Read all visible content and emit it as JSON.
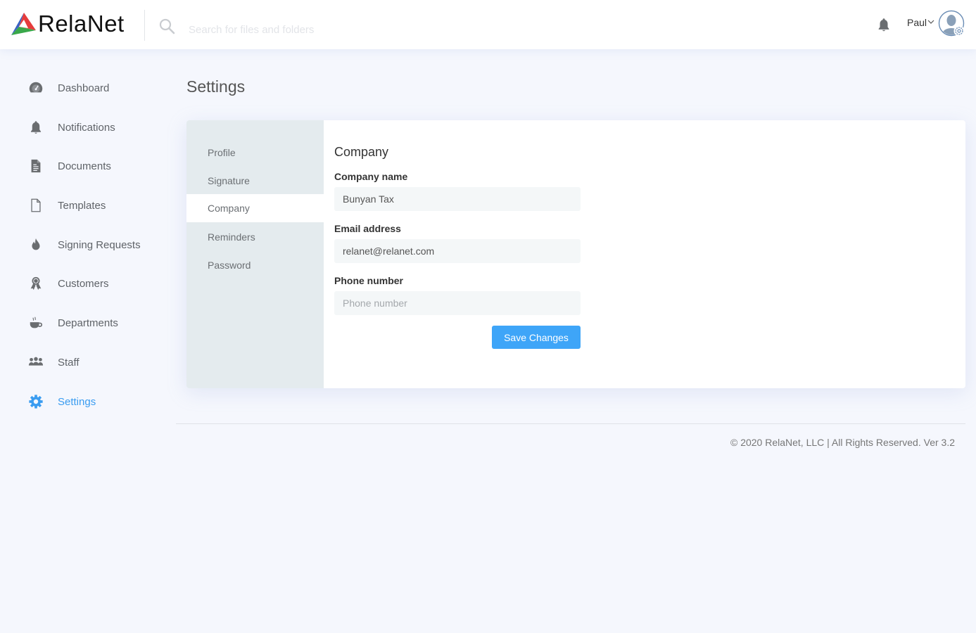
{
  "app": {
    "brand": "RelaNet",
    "brand_colors": {
      "red": "#e63c3c",
      "blue": "#3a62c2",
      "green": "#3aa84a"
    },
    "accent": "#3ea5f8"
  },
  "header": {
    "search_placeholder": "Search for files and folders",
    "search_value": "",
    "icons": {
      "search": "search-icon",
      "notifications": "bell-icon",
      "user_menu": "chevron-down-icon",
      "avatar": "user-settings-avatar-icon"
    },
    "user_name": "Paul"
  },
  "sidebar": {
    "items": [
      {
        "label": "Dashboard",
        "icon": "dashboard-gauge-icon",
        "active": false
      },
      {
        "label": "Notifications",
        "icon": "bell-icon",
        "active": false
      },
      {
        "label": "Documents",
        "icon": "document-icon",
        "active": false
      },
      {
        "label": "Templates",
        "icon": "blank-file-icon",
        "active": false
      },
      {
        "label": "Signing Requests",
        "icon": "flame-icon",
        "active": false
      },
      {
        "label": "Customers",
        "icon": "award-ribbon-icon",
        "active": false
      },
      {
        "label": "Departments",
        "icon": "coffee-cup-icon",
        "active": false
      },
      {
        "label": "Staff",
        "icon": "group-icon",
        "active": false
      },
      {
        "label": "Settings",
        "icon": "gear-icon",
        "active": true
      }
    ]
  },
  "page": {
    "title": "Settings"
  },
  "settings_tabs": [
    {
      "label": "Profile",
      "active": false
    },
    {
      "label": "Signature",
      "active": false
    },
    {
      "label": "Company",
      "active": true
    },
    {
      "label": "Reminders",
      "active": false
    },
    {
      "label": "Password",
      "active": false
    }
  ],
  "form": {
    "title": "Company",
    "fields": [
      {
        "label": "Company name",
        "value": "Bunyan Tax",
        "placeholder": "Company name"
      },
      {
        "label": "Email address",
        "value": "relanet@relanet.com",
        "placeholder": "Email address"
      },
      {
        "label": "Phone number",
        "value": "",
        "placeholder": "Phone number"
      }
    ],
    "save_label": "Save Changes"
  },
  "footer": {
    "text": "© 2020 RelaNet, LLC | All Rights Reserved. Ver 3.2"
  }
}
